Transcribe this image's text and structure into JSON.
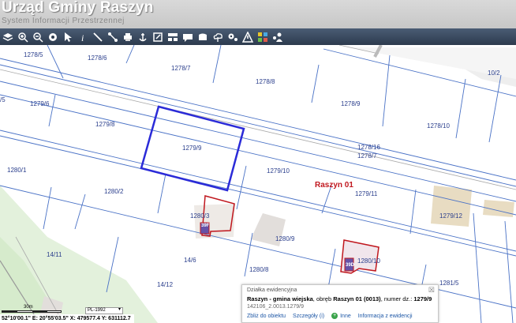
{
  "app": {
    "title": "Urząd Gminy Raszyn",
    "subtitle": "System Informacji Przestrzennej"
  },
  "toolbar": {
    "tools": [
      {
        "name": "layers-icon"
      },
      {
        "name": "zoom-in-icon"
      },
      {
        "name": "zoom-out-icon"
      },
      {
        "name": "full-extent-icon"
      },
      {
        "name": "select-arrow-icon"
      },
      {
        "name": "info-icon"
      },
      {
        "name": "measure-line-icon"
      },
      {
        "name": "pin-icon"
      },
      {
        "name": "print-icon"
      },
      {
        "name": "anchor-icon"
      },
      {
        "name": "export-icon"
      },
      {
        "name": "layout-icon"
      },
      {
        "name": "comment-icon"
      },
      {
        "name": "mail-icon"
      },
      {
        "name": "upload-icon"
      },
      {
        "name": "settings-icon"
      },
      {
        "name": "warning-icon"
      },
      {
        "name": "color-grid-icon"
      },
      {
        "name": "users-icon"
      }
    ]
  },
  "map": {
    "precinct_label": "Raszyn 01",
    "parcel_labels": [
      "1278/5",
      "1278/6",
      "1278/7",
      "1278/8",
      "1278/9",
      "1278/10",
      "10/2",
      "/5",
      "1279/6",
      "1279/8",
      "1279/9",
      "1278/16",
      "1278/7",
      "1279/10",
      "1280/1",
      "1280/2",
      "1279/11",
      "1279/12",
      "1280/3",
      "1280/9",
      "1280/8",
      "1280/10",
      "14/11",
      "14/6",
      "14/12",
      "1281/5"
    ],
    "building_badges": [
      "39F",
      "39D"
    ]
  },
  "scale": {
    "label": "30m",
    "crs": "PL-1992"
  },
  "status": {
    "coordinates": "52°10'00.1\"  E: 20°55'03.5\"  X: 479577.4  Y: 631112.7"
  },
  "info_panel": {
    "title": "Działka ewidencyjna",
    "municipality": "Raszyn - gmina wiejska",
    "precinct_prefix": ", obręb ",
    "precinct": "Raszyn 01 (0013)",
    "number_prefix": ", numer dz.: ",
    "number": "1279/9",
    "identifier": "142106_2.0013.1279/9",
    "actions": {
      "zoom": "Zbliż do obiektu",
      "neighbors": "Szczegóły (i)",
      "other": "Inne",
      "register": "Informacja z ewidencji"
    }
  },
  "colors": {
    "selected_parcel": "#2b2bd8",
    "building_outline": "#c0171e",
    "parcel_lines": "#4a72c6",
    "green_area": "#e3f1dc"
  }
}
